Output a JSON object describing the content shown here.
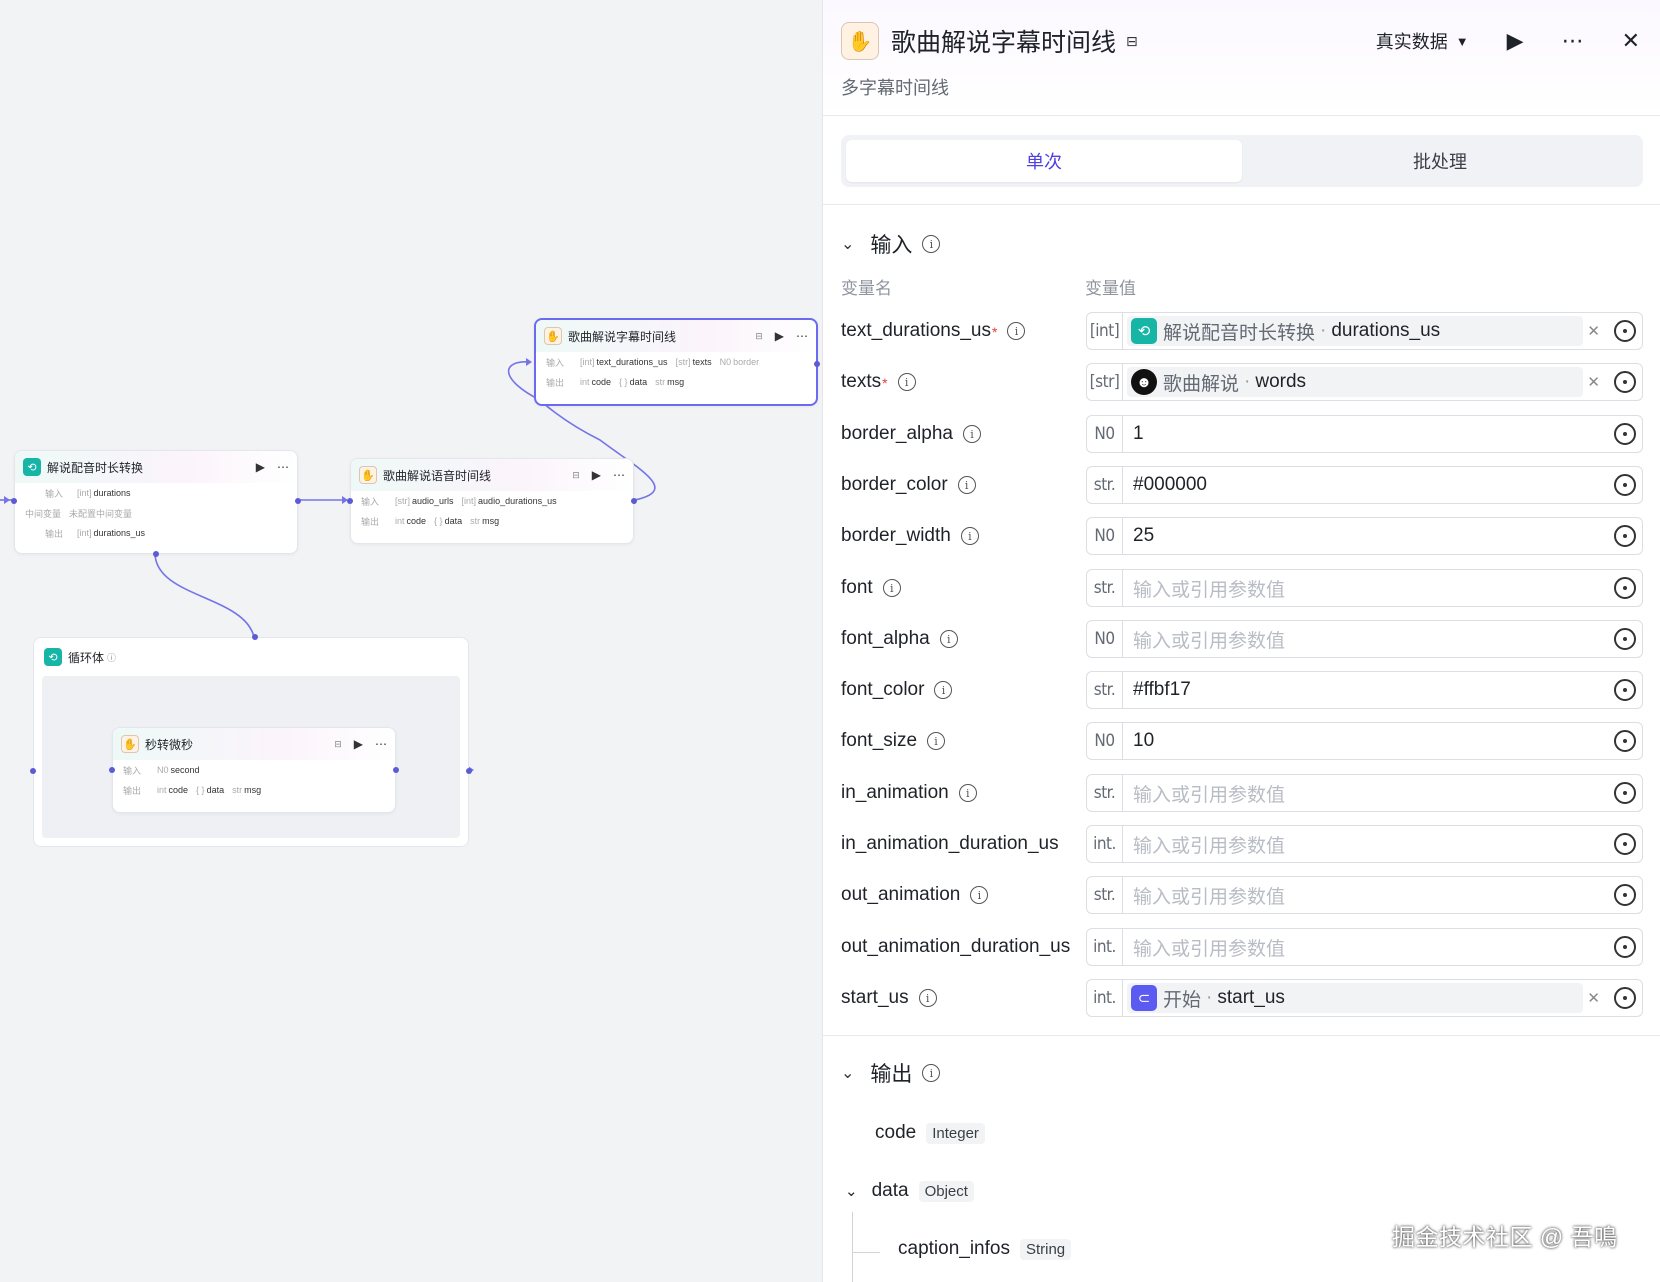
{
  "canvas": {
    "nodes": {
      "subtitle_node": {
        "title": "歌曲解说字幕时间线",
        "input_label": "输入",
        "output_label": "输出",
        "inputs": [
          {
            "type": "[int]",
            "name": "text_durations_us"
          },
          {
            "type": "[str]",
            "name": "texts"
          },
          {
            "type": "N0",
            "name": "border"
          }
        ],
        "outputs": [
          {
            "type": "int",
            "name": "code"
          },
          {
            "type": "{ }",
            "name": "data"
          },
          {
            "type": "str",
            "name": "msg"
          }
        ]
      },
      "convert_node": {
        "title": "解说配音时长转换",
        "input_label": "输入",
        "mid_label": "中间变量",
        "mid_value": "未配置中间变量",
        "output_label": "输出",
        "input": {
          "type": "[int]",
          "name": "durations"
        },
        "output": {
          "type": "[int]",
          "name": "durations_us"
        }
      },
      "voice_node": {
        "title": "歌曲解说语音时间线",
        "input_label": "输入",
        "output_label": "输出",
        "inputs": [
          {
            "type": "[str]",
            "name": "audio_urls"
          },
          {
            "type": "[int]",
            "name": "audio_durations_us"
          }
        ],
        "outputs": [
          {
            "type": "int",
            "name": "code"
          },
          {
            "type": "{ }",
            "name": "data"
          },
          {
            "type": "str",
            "name": "msg"
          }
        ]
      },
      "loop": {
        "title": "循环体"
      },
      "sec_node": {
        "title": "秒转微秒",
        "input_label": "输入",
        "output_label": "输出",
        "input": {
          "type": "N0",
          "name": "second"
        },
        "outputs": [
          {
            "type": "int",
            "name": "code"
          },
          {
            "type": "{ }",
            "name": "data"
          },
          {
            "type": "str",
            "name": "msg"
          }
        ]
      }
    }
  },
  "panel": {
    "title": "歌曲解说字幕时间线",
    "subtitle": "多字幕时间线",
    "mode": "真实数据",
    "tabs": [
      "单次",
      "批处理"
    ],
    "input_section": "输入",
    "col_name": "变量名",
    "col_value": "变量值",
    "placeholder": "输入或引用参数值",
    "params": [
      {
        "name": "text_durations_us",
        "required": true,
        "type": "[int]",
        "ref": {
          "icon": "loop",
          "node": "解说配音时长转换",
          "var": "durations_us"
        }
      },
      {
        "name": "texts",
        "required": true,
        "type": "[str]",
        "ref": {
          "icon": "avatar",
          "node": "歌曲解说",
          "var": "words"
        }
      },
      {
        "name": "border_alpha",
        "type": "N0",
        "value": "1"
      },
      {
        "name": "border_color",
        "type": "str.",
        "value": "#000000"
      },
      {
        "name": "border_width",
        "type": "N0",
        "value": "25"
      },
      {
        "name": "font",
        "type": "str.",
        "value": ""
      },
      {
        "name": "font_alpha",
        "type": "N0",
        "value": ""
      },
      {
        "name": "font_color",
        "type": "str.",
        "value": "#ffbf17"
      },
      {
        "name": "font_size",
        "type": "N0",
        "value": "10"
      },
      {
        "name": "in_animation",
        "type": "str.",
        "value": ""
      },
      {
        "name": "in_animation_duration_us",
        "type": "int.",
        "value": ""
      },
      {
        "name": "out_animation",
        "type": "str.",
        "value": ""
      },
      {
        "name": "out_animation_duration_us",
        "type": "int.",
        "value": ""
      },
      {
        "name": "start_us",
        "type": "int.",
        "ref": {
          "icon": "start",
          "node": "开始",
          "var": "start_us"
        }
      }
    ],
    "output_section": "输出",
    "outputs": [
      {
        "name": "code",
        "type": "Integer"
      },
      {
        "name": "data",
        "type": "Object"
      },
      {
        "name": "caption_infos",
        "type": "String"
      }
    ]
  },
  "watermark": "掘金技术社区 @ 吾鳴"
}
